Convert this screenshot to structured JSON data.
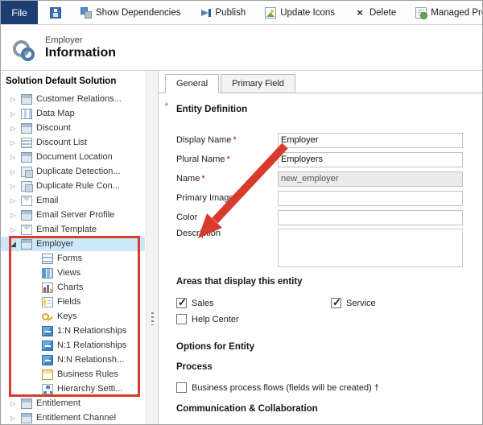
{
  "toolbar": {
    "file_label": "File",
    "items": [
      {
        "name": "save-button",
        "label": "",
        "icon": "save-icon"
      },
      {
        "name": "show-dependencies-button",
        "label": "Show Dependencies",
        "icon": "dependencies-icon"
      },
      {
        "name": "publish-button",
        "label": "Publish",
        "icon": "publish-icon"
      },
      {
        "name": "update-icons-button",
        "label": "Update Icons",
        "icon": "update-icons-icon"
      },
      {
        "name": "delete-button",
        "label": "Delete",
        "icon": "delete-icon"
      },
      {
        "name": "managed-properties-button",
        "label": "Managed Prop",
        "icon": "managed-properties-icon"
      }
    ]
  },
  "header": {
    "entity_name": "Employer",
    "page_title": "Information"
  },
  "sidebar": {
    "title": "Solution Default Solution",
    "items": [
      {
        "label": "Customer Relations...",
        "icon": "entity",
        "expand": "collapsed",
        "level": 0
      },
      {
        "label": "Data Map",
        "icon": "map",
        "expand": "collapsed",
        "level": 0
      },
      {
        "label": "Discount",
        "icon": "entity",
        "expand": "collapsed",
        "level": 0
      },
      {
        "label": "Discount List",
        "icon": "list",
        "expand": "collapsed",
        "level": 0
      },
      {
        "label": "Document Location",
        "icon": "entity",
        "expand": "collapsed",
        "level": 0
      },
      {
        "label": "Duplicate Detection...",
        "icon": "dup",
        "expand": "collapsed",
        "level": 0
      },
      {
        "label": "Duplicate Rule Con...",
        "icon": "dup",
        "expand": "collapsed",
        "level": 0
      },
      {
        "label": "Email",
        "icon": "mail",
        "expand": "collapsed",
        "level": 0
      },
      {
        "label": "Email Server Profile",
        "icon": "entity",
        "expand": "collapsed",
        "level": 0
      },
      {
        "label": "Email Template",
        "icon": "mail",
        "expand": "collapsed",
        "level": 0
      },
      {
        "label": "Employer",
        "icon": "entity",
        "expand": "expanded",
        "level": 0,
        "selected": true
      },
      {
        "label": "Forms",
        "icon": "form",
        "level": 1
      },
      {
        "label": "Views",
        "icon": "view",
        "level": 1
      },
      {
        "label": "Charts",
        "icon": "chart",
        "level": 1
      },
      {
        "label": "Fields",
        "icon": "fields",
        "level": 1
      },
      {
        "label": "Keys",
        "icon": "key",
        "level": 1
      },
      {
        "label": "1:N Relationships",
        "icon": "rel",
        "level": 1
      },
      {
        "label": "N:1 Relationships",
        "icon": "rel",
        "level": 1
      },
      {
        "label": "N:N Relationsh...",
        "icon": "rel",
        "level": 1
      },
      {
        "label": "Business Rules",
        "icon": "rules",
        "level": 1
      },
      {
        "label": "Hierarchy Setti...",
        "icon": "hier",
        "level": 1
      },
      {
        "label": "Entitlement",
        "icon": "entity",
        "expand": "collapsed",
        "level": 0
      },
      {
        "label": "Entitlement Channel",
        "icon": "entity",
        "expand": "collapsed",
        "level": 0
      }
    ]
  },
  "tabs": [
    {
      "label": "General",
      "active": true
    },
    {
      "label": "Primary Field",
      "active": false
    }
  ],
  "main": {
    "entity_definition_heading": "Entity Definition",
    "fields": [
      {
        "label": "Display Name",
        "required": true,
        "value": "Employer",
        "disabled": false,
        "multiline": false
      },
      {
        "label": "Plural Name",
        "required": true,
        "value": "Employers",
        "disabled": false,
        "multiline": false
      },
      {
        "label": "Name",
        "required": true,
        "value": "new_employer",
        "disabled": true,
        "multiline": false
      },
      {
        "label": "Primary Image",
        "required": false,
        "value": "",
        "disabled": false,
        "multiline": false
      },
      {
        "label": "Color",
        "required": false,
        "value": "",
        "disabled": false,
        "multiline": false
      },
      {
        "label": "Description",
        "required": false,
        "value": "",
        "disabled": false,
        "multiline": true
      }
    ],
    "areas_heading": "Areas that display this entity",
    "areas": [
      {
        "label": "Sales",
        "checked": true
      },
      {
        "label": "Service",
        "checked": true
      },
      {
        "label": "Help Center",
        "checked": false
      }
    ],
    "options_heading": "Options for Entity",
    "process_heading": "Process",
    "process_option": {
      "label": "Business process flows (fields will be created) †",
      "checked": false
    },
    "communication_heading": "Communication & Collaboration"
  },
  "colors": {
    "annotation_red": "#d93a2e",
    "selection_blue": "#cbe7f8",
    "file_button_blue": "#1d3e73"
  }
}
